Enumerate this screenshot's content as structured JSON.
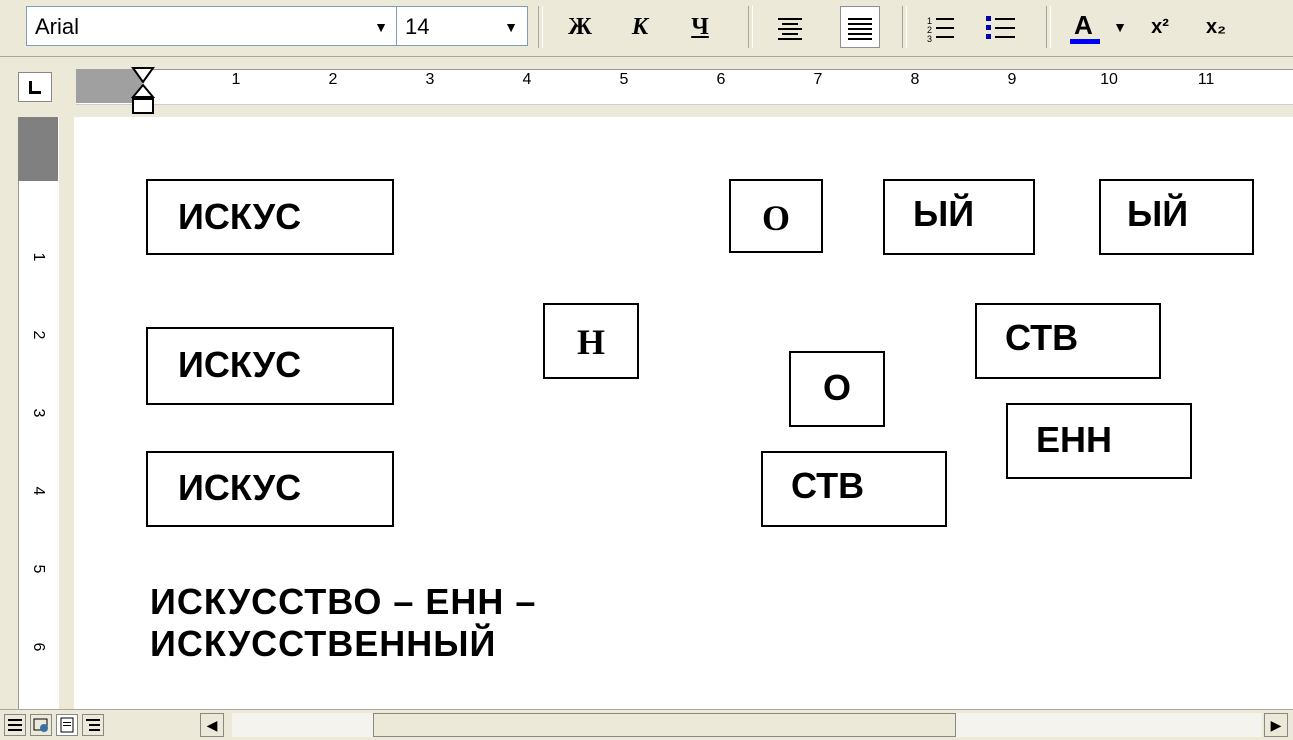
{
  "toolbar": {
    "font_name": "Arial",
    "font_size": "14",
    "bold_label": "Ж",
    "italic_label": "К",
    "underline_label": "Ч",
    "superscript_label": "x²",
    "subscript_label": "x₂",
    "font_color": "#0000ff"
  },
  "ruler": {
    "h_labels": [
      "1",
      "2",
      "3",
      "4",
      "5",
      "6",
      "7",
      "8",
      "9",
      "10",
      "11"
    ],
    "v_labels": [
      "1",
      "2",
      "3",
      "4",
      "5",
      "6"
    ]
  },
  "document": {
    "boxes": {
      "iskus_1": "ИСКУС",
      "iskus_2": "ИСКУС",
      "iskus_3": "ИСКУС",
      "o_top": "О",
      "yy_1": "ЫЙ",
      "yy_2": "ЫЙ",
      "n": "Н",
      "stv_1": "СТВ",
      "o_mid": "О",
      "enn": "ЕНН",
      "stv_2": "СТВ"
    },
    "result_line1": "ИСКУССТВО – ЕНН –",
    "result_line2": "ИСКУССТВЕННЫЙ"
  }
}
